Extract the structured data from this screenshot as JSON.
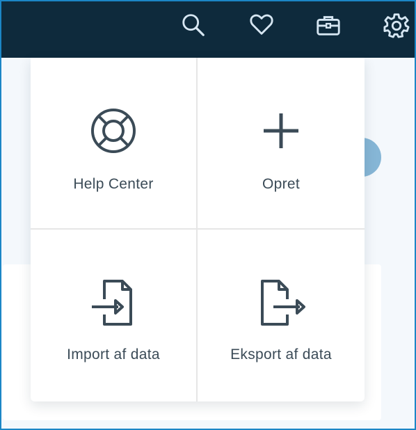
{
  "topbar": {
    "icons": [
      "search-icon",
      "heart-icon",
      "toolbox-icon",
      "gear-icon"
    ],
    "background": "#0e2a3c",
    "icon_color": "#d6e6f2"
  },
  "menu": {
    "tiles": [
      {
        "label": "Help Center",
        "icon": "lifebuoy-icon"
      },
      {
        "label": "Opret",
        "icon": "plus-icon"
      },
      {
        "label": "Import af data",
        "icon": "file-import-icon"
      },
      {
        "label": "Eksport af data",
        "icon": "file-export-icon"
      }
    ],
    "icon_color": "#3b4b57"
  }
}
